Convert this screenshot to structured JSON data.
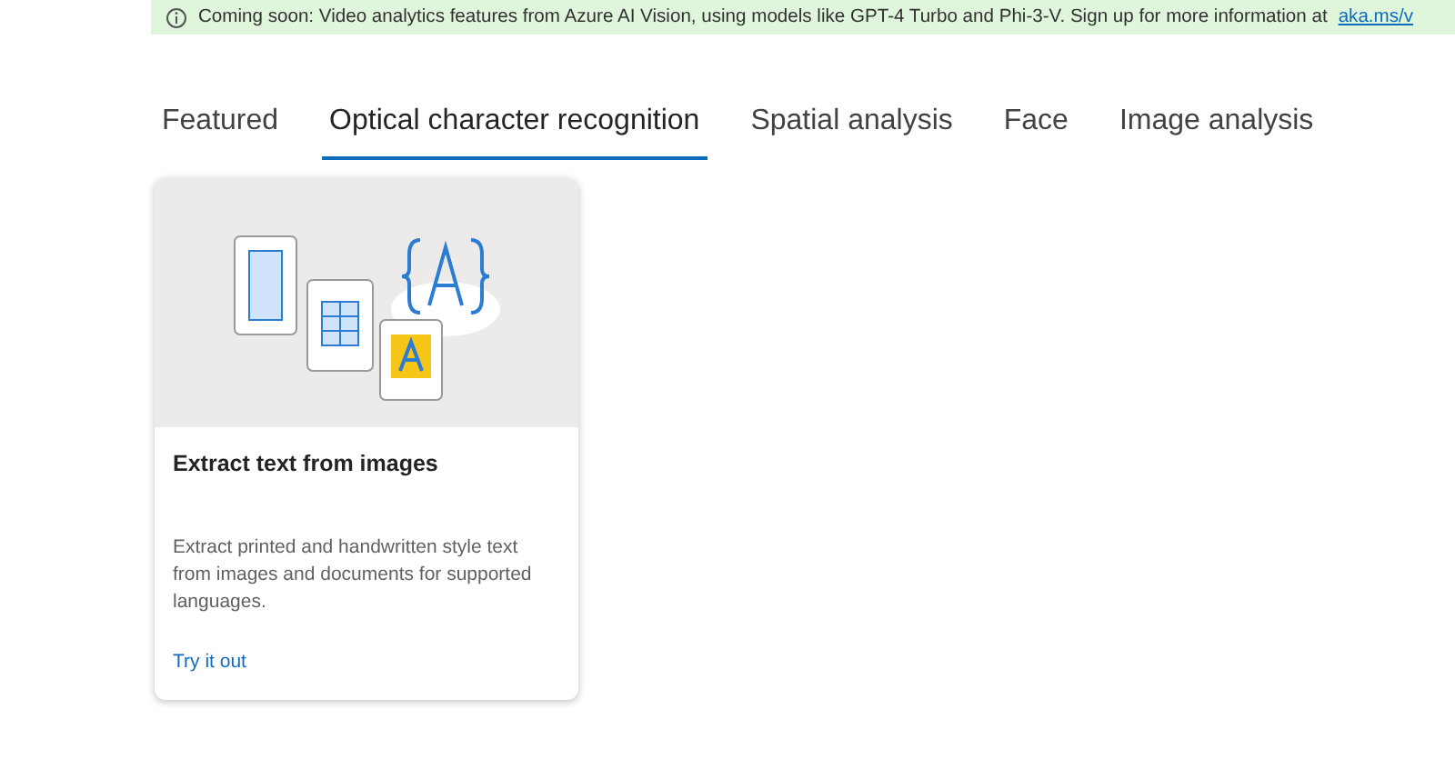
{
  "banner": {
    "text": "Coming soon: Video analytics features from Azure AI Vision, using models like GPT-4 Turbo and Phi-3-V. Sign up for more information at",
    "link": "aka.ms/v"
  },
  "tabs": [
    {
      "label": "Featured",
      "selected": false
    },
    {
      "label": "Optical character recognition",
      "selected": true
    },
    {
      "label": "Spatial analysis",
      "selected": false
    },
    {
      "label": "Face",
      "selected": false
    },
    {
      "label": "Image analysis",
      "selected": false
    }
  ],
  "cards": [
    {
      "title": "Extract text from images",
      "description": "Extract printed and handwritten style text from images and documents for supported languages.",
      "link": "Try it out"
    }
  ]
}
